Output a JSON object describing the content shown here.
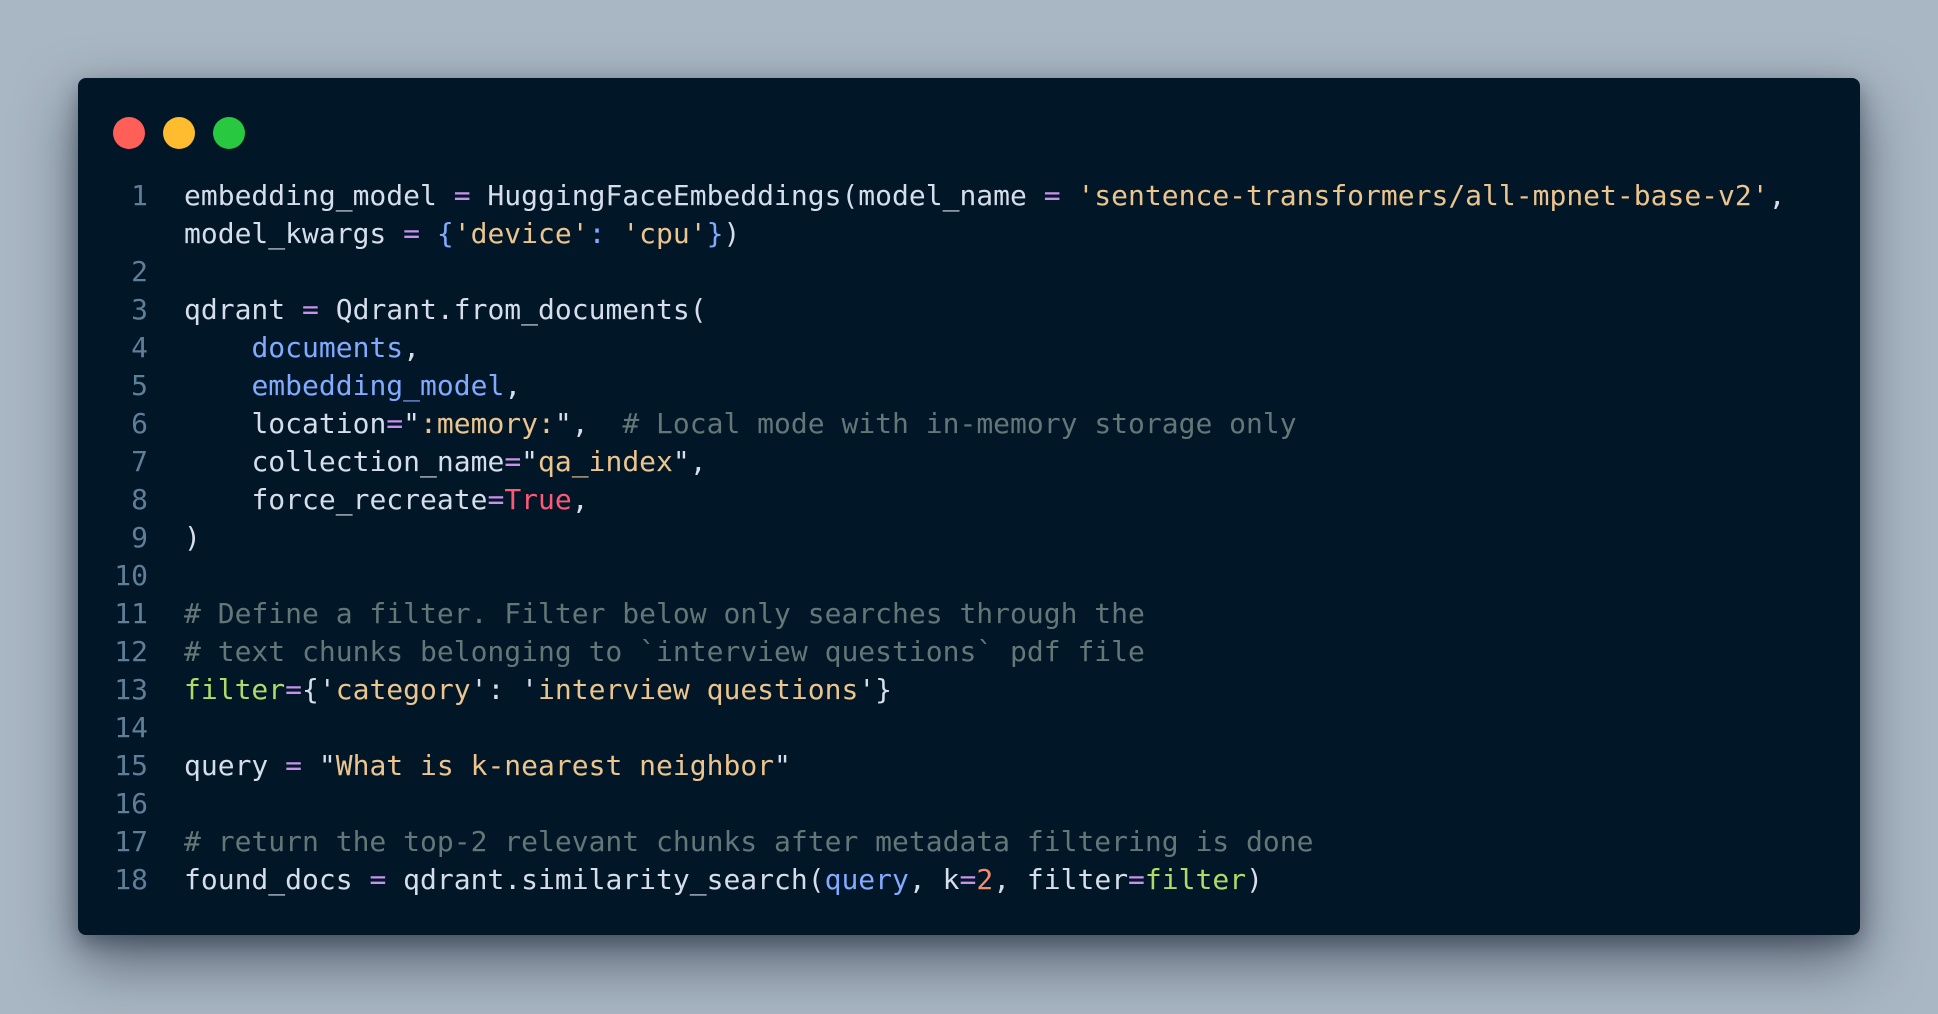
{
  "window": {
    "controls": [
      "close",
      "minimize",
      "maximize"
    ]
  },
  "code": {
    "language": "python",
    "lines": [
      {
        "n": "1",
        "tokens": [
          {
            "t": "embedding_model ",
            "c": "plain"
          },
          {
            "t": "=",
            "c": "op"
          },
          {
            "t": " HuggingFaceEmbeddings(model_name ",
            "c": "plain"
          },
          {
            "t": "=",
            "c": "op"
          },
          {
            "t": " ",
            "c": "plain"
          },
          {
            "t": "'sentence-transformers/all-mpnet-base-v2'",
            "c": "str"
          },
          {
            "t": ", model_kwargs ",
            "c": "plain"
          },
          {
            "t": "=",
            "c": "op"
          },
          {
            "t": " ",
            "c": "plain"
          },
          {
            "t": "{",
            "c": "prm"
          },
          {
            "t": "'device'",
            "c": "str"
          },
          {
            "t": ":",
            "c": "prm"
          },
          {
            "t": " ",
            "c": "plain"
          },
          {
            "t": "'cpu'",
            "c": "str"
          },
          {
            "t": "}",
            "c": "prm"
          },
          {
            "t": ")",
            "c": "plain"
          }
        ]
      },
      {
        "n": "2",
        "tokens": []
      },
      {
        "n": "3",
        "tokens": [
          {
            "t": "qdrant ",
            "c": "plain"
          },
          {
            "t": "=",
            "c": "op"
          },
          {
            "t": " Qdrant.from_documents(",
            "c": "plain"
          }
        ]
      },
      {
        "n": "4",
        "tokens": [
          {
            "t": "    ",
            "c": "plain"
          },
          {
            "t": "documents",
            "c": "prm"
          },
          {
            "t": ",",
            "c": "plain"
          }
        ]
      },
      {
        "n": "5",
        "tokens": [
          {
            "t": "    ",
            "c": "plain"
          },
          {
            "t": "embedding_model",
            "c": "prm"
          },
          {
            "t": ",",
            "c": "plain"
          }
        ]
      },
      {
        "n": "6",
        "tokens": [
          {
            "t": "    location",
            "c": "plain"
          },
          {
            "t": "=",
            "c": "op"
          },
          {
            "t": "\"",
            "c": "plain"
          },
          {
            "t": ":memory:",
            "c": "str"
          },
          {
            "t": "\",  ",
            "c": "plain"
          },
          {
            "t": "# Local mode with in-memory storage only",
            "c": "cm"
          }
        ]
      },
      {
        "n": "7",
        "tokens": [
          {
            "t": "    collection_name",
            "c": "plain"
          },
          {
            "t": "=",
            "c": "op"
          },
          {
            "t": "\"",
            "c": "plain"
          },
          {
            "t": "qa_index",
            "c": "str"
          },
          {
            "t": "\",",
            "c": "plain"
          }
        ]
      },
      {
        "n": "8",
        "tokens": [
          {
            "t": "    force_recreate",
            "c": "plain"
          },
          {
            "t": "=",
            "c": "op"
          },
          {
            "t": "True",
            "c": "kw"
          },
          {
            "t": ",",
            "c": "plain"
          }
        ]
      },
      {
        "n": "9",
        "tokens": [
          {
            "t": ")",
            "c": "plain"
          }
        ]
      },
      {
        "n": "10",
        "tokens": []
      },
      {
        "n": "11",
        "tokens": [
          {
            "t": "# Define a filter. Filter below only searches through the",
            "c": "cm"
          }
        ]
      },
      {
        "n": "12",
        "tokens": [
          {
            "t": "# text chunks belonging to `interview questions` pdf file",
            "c": "cm"
          }
        ]
      },
      {
        "n": "13",
        "tokens": [
          {
            "t": "filter",
            "c": "fn"
          },
          {
            "t": "=",
            "c": "op"
          },
          {
            "t": "{'",
            "c": "plain"
          },
          {
            "t": "category",
            "c": "str"
          },
          {
            "t": "': '",
            "c": "plain"
          },
          {
            "t": "interview questions",
            "c": "str"
          },
          {
            "t": "'}",
            "c": "plain"
          }
        ]
      },
      {
        "n": "14",
        "tokens": []
      },
      {
        "n": "15",
        "tokens": [
          {
            "t": "query ",
            "c": "plain"
          },
          {
            "t": "=",
            "c": "op"
          },
          {
            "t": " \"",
            "c": "plain"
          },
          {
            "t": "What is k-nearest neighbor",
            "c": "str"
          },
          {
            "t": "\"",
            "c": "plain"
          }
        ]
      },
      {
        "n": "16",
        "tokens": []
      },
      {
        "n": "17",
        "tokens": [
          {
            "t": "# return the top-2 relevant chunks after metadata filtering is done",
            "c": "cm"
          }
        ]
      },
      {
        "n": "18",
        "tokens": [
          {
            "t": "found_docs ",
            "c": "plain"
          },
          {
            "t": "=",
            "c": "op"
          },
          {
            "t": " qdrant.similarity_search(",
            "c": "plain"
          },
          {
            "t": "query",
            "c": "prm"
          },
          {
            "t": ", k",
            "c": "plain"
          },
          {
            "t": "=",
            "c": "op"
          },
          {
            "t": "2",
            "c": "num"
          },
          {
            "t": ", filter",
            "c": "plain"
          },
          {
            "t": "=",
            "c": "op"
          },
          {
            "t": "filter",
            "c": "fn"
          },
          {
            "t": ")",
            "c": "plain"
          }
        ]
      }
    ]
  }
}
